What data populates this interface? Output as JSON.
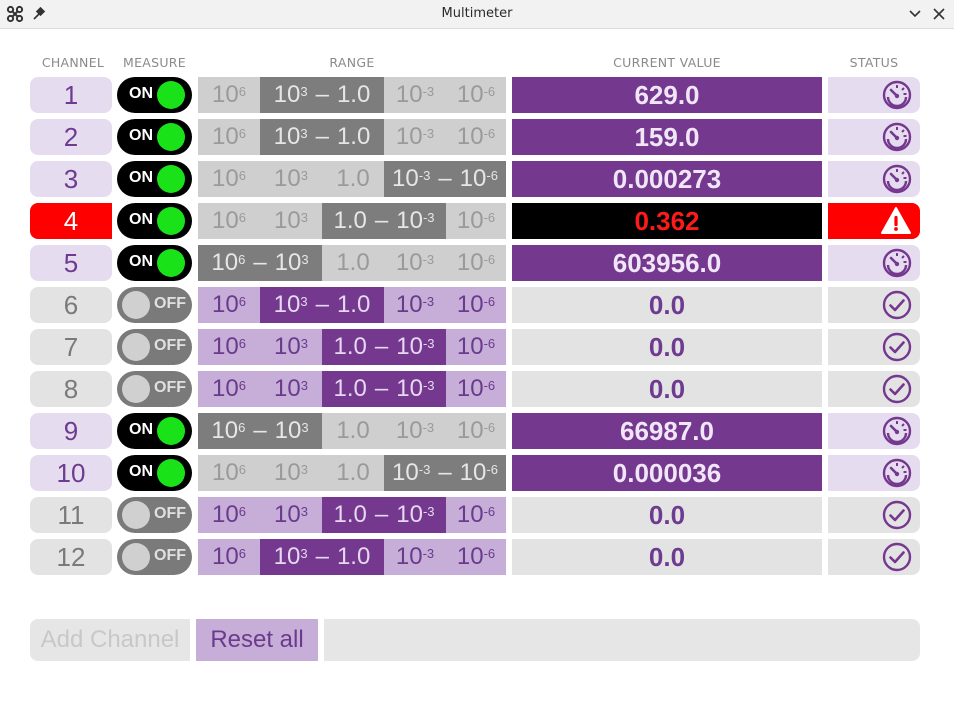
{
  "window": {
    "title": "Multimeter"
  },
  "headers": {
    "channel": "CHANNEL",
    "measure": "MEASURE",
    "range": "RANGE",
    "value": "CURRENT VALUE",
    "status": "STATUS"
  },
  "colors": {
    "accent": "#74388f",
    "alarm": "#ff0000",
    "toggle_on_knob": "#19e219"
  },
  "channels": [
    {
      "id": "1",
      "measure": "ON",
      "range": "10^3 – 1.0",
      "value": "629.0",
      "status": "gauge-icon",
      "state": "on"
    },
    {
      "id": "2",
      "measure": "ON",
      "range": "10^3 – 1.0",
      "value": "159.0",
      "status": "gauge-icon",
      "state": "on"
    },
    {
      "id": "3",
      "measure": "ON",
      "range": "10^-3 – 10^-6",
      "value": "0.000273",
      "status": "gauge-icon",
      "state": "on"
    },
    {
      "id": "4",
      "measure": "ON",
      "range": "1.0 – 10^-3",
      "value": "0.362",
      "status": "warning-icon",
      "state": "alarm"
    },
    {
      "id": "5",
      "measure": "ON",
      "range": "10^6 – 10^3",
      "value": "603956.0",
      "status": "gauge-icon",
      "state": "on"
    },
    {
      "id": "6",
      "measure": "OFF",
      "range": "10^3 – 1.0",
      "value": "0.0",
      "status": "check-icon",
      "state": "off"
    },
    {
      "id": "7",
      "measure": "OFF",
      "range": "1.0 – 10^-3",
      "value": "0.0",
      "status": "check-icon",
      "state": "off"
    },
    {
      "id": "8",
      "measure": "OFF",
      "range": "1.0 – 10^-3",
      "value": "0.0",
      "status": "check-icon",
      "state": "off"
    },
    {
      "id": "9",
      "measure": "ON",
      "range": "10^6 – 10^3",
      "value": "66987.0",
      "status": "gauge-icon",
      "state": "on"
    },
    {
      "id": "10",
      "measure": "ON",
      "range": "10^-3 – 10^-6",
      "value": "0.000036",
      "status": "gauge-icon",
      "state": "on"
    },
    {
      "id": "11",
      "measure": "OFF",
      "range": "1.0 – 10^-3",
      "value": "0.0",
      "status": "check-icon",
      "state": "off"
    },
    {
      "id": "12",
      "measure": "OFF",
      "range": "10^3 – 1.0",
      "value": "0.0",
      "status": "check-icon",
      "state": "off"
    }
  ],
  "footer": {
    "add_label": "Add Channel",
    "reset_label": "Reset all"
  }
}
